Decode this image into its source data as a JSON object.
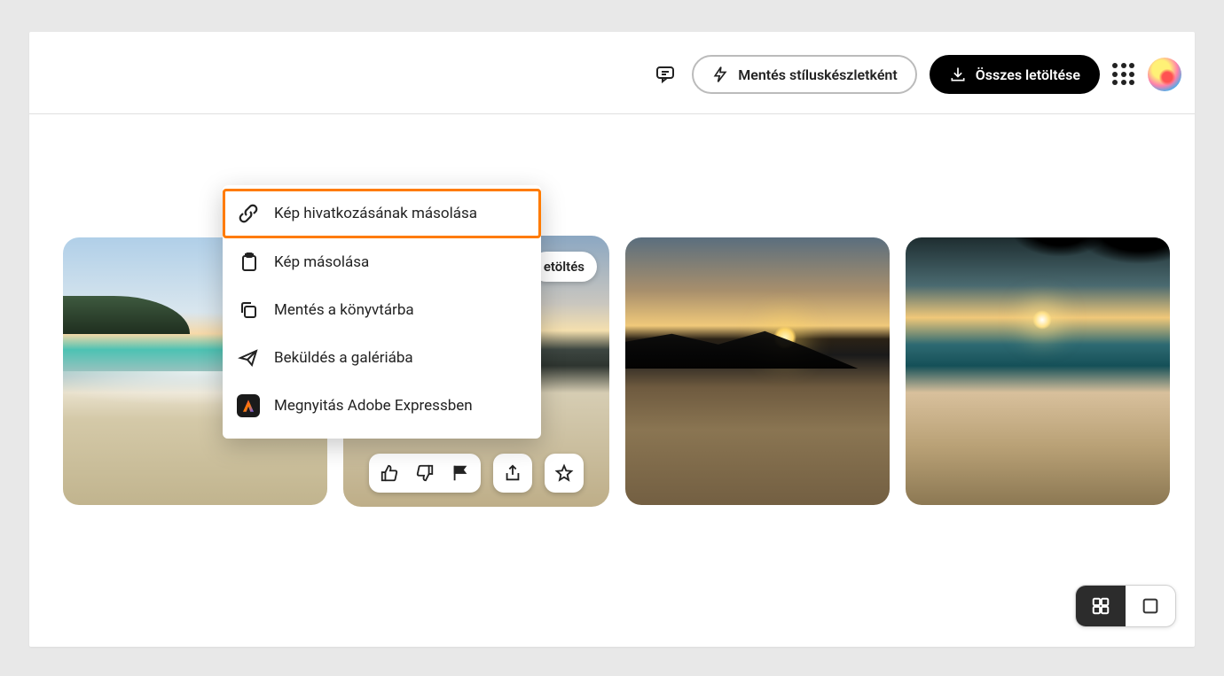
{
  "toolbar": {
    "save_styleset_label": "Mentés stíluskészletként",
    "download_all_label": "Összes letöltése"
  },
  "thumbnail": {
    "download_label": "etöltés"
  },
  "context_menu": {
    "items": [
      {
        "label": "Kép hivatkozásának másolása"
      },
      {
        "label": "Kép másolása"
      },
      {
        "label": "Mentés a könyvtárba"
      },
      {
        "label": "Beküldés a galériába"
      },
      {
        "label": "Megnyitás Adobe Expressben"
      }
    ]
  }
}
